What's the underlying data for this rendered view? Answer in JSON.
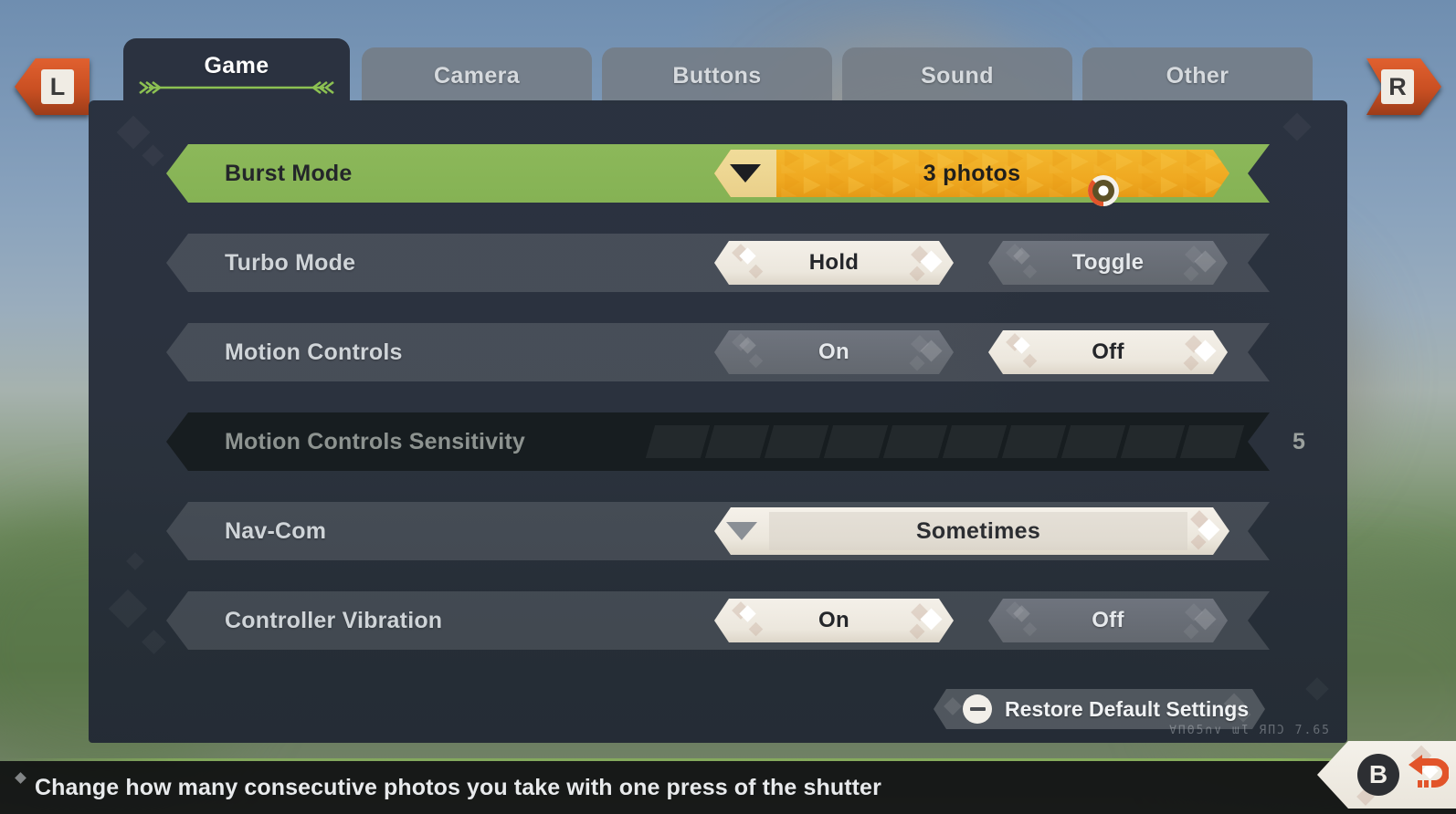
{
  "bumpers": {
    "left": "L",
    "right": "R"
  },
  "tabs": [
    {
      "label": "Game",
      "active": true
    },
    {
      "label": "Camera",
      "active": false
    },
    {
      "label": "Buttons",
      "active": false
    },
    {
      "label": "Sound",
      "active": false
    },
    {
      "label": "Other",
      "active": false
    }
  ],
  "settings": [
    {
      "label": "Burst Mode",
      "type": "dropdown",
      "value": "3 photos",
      "state": "highlighted"
    },
    {
      "label": "Turbo Mode",
      "type": "choice",
      "options": [
        "Hold",
        "Toggle"
      ],
      "selected": "Hold",
      "state": "normal"
    },
    {
      "label": "Motion Controls",
      "type": "choice",
      "options": [
        "On",
        "Off"
      ],
      "selected": "Off",
      "state": "normal"
    },
    {
      "label": "Motion Controls Sensitivity",
      "type": "slider",
      "value": "5",
      "segments": 10,
      "filled": 0,
      "state": "disabled"
    },
    {
      "label": "Nav-Com",
      "type": "dropdown",
      "value": "Sometimes",
      "state": "normal"
    },
    {
      "label": "Controller Vibration",
      "type": "choice",
      "options": [
        "On",
        "Off"
      ],
      "selected": "On",
      "state": "normal"
    }
  ],
  "restore_button": {
    "label": "Restore Default Settings",
    "icon": "minus-circle-icon"
  },
  "decorative_glyphs": "∀ΠΘ5∩∨  ɯƖ  ЯПƆ  7.65",
  "footer": {
    "hint": "Change how many consecutive photos you take with one press of the shutter",
    "back_button": {
      "key": "B",
      "icon": "back-arrow-icon"
    }
  },
  "colors": {
    "highlight_green": "#8cb85a",
    "dropdown_amber": "#efa820",
    "bumper_orange": "#c94f22",
    "panel_dark": "#2b3240",
    "selected_cream": "#ece7dd",
    "unselected_grey": "#63686f",
    "cursor_orange": "#e2542a"
  }
}
